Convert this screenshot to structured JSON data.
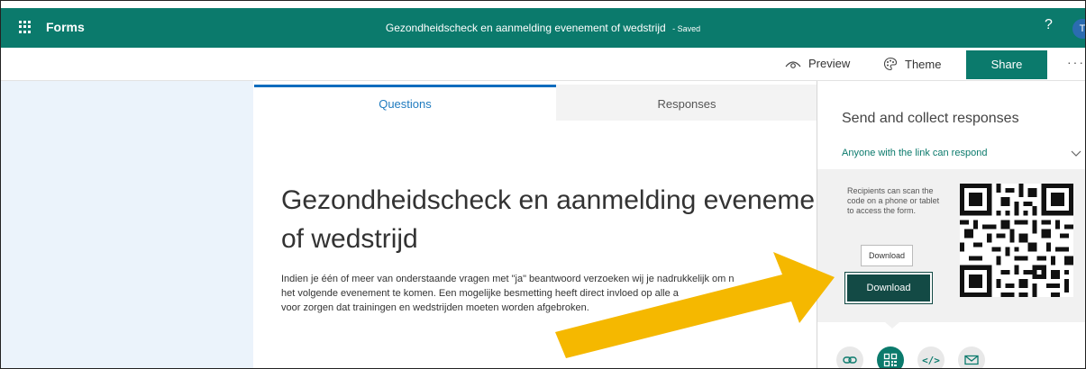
{
  "topbar": {
    "app_name": "Forms",
    "document_title": "Gezondheidscheck en aanmelding evenement of wedstrijd",
    "save_status": "- Saved",
    "help": "?",
    "avatar_initial": "T"
  },
  "commandbar": {
    "preview_label": "Preview",
    "theme_label": "Theme",
    "share_label": "Share",
    "more_label": "···"
  },
  "tabs": [
    {
      "label": "Questions",
      "selected": true
    },
    {
      "label": "Responses",
      "selected": false
    }
  ],
  "form": {
    "title_lines": [
      "Gezondheidscheck en aanmelding evenement",
      "of wedstrijd"
    ],
    "description_lines": [
      "Indien je één of meer van onderstaande vragen met \"ja\" beantwoord verzoeken wij je nadrukkelijk om n",
      "het volgende evenement te komen. Een mogelijke besmetting heeft direct invloed op alle a",
      "voor zorgen dat trainingen en wedstrijden moeten worden afgebroken."
    ]
  },
  "share_panel": {
    "title": "Send and collect responses",
    "link_scope": "Anyone with the link can respond",
    "qr_note": "Recipients can scan the code on a phone or tablet to access the form.",
    "download_small": "Download",
    "download_primary": "Download",
    "share_methods": [
      "link-icon",
      "qr-code-icon",
      "embed-icon",
      "email-icon"
    ],
    "embed_glyph": "</>"
  },
  "colors": {
    "brand": "#0b7a6c",
    "download_primary": "#134a45",
    "tab_accent": "#0f6cbd",
    "background_tint": "#ebf3fb",
    "annotation_arrow": "#f5b800"
  }
}
